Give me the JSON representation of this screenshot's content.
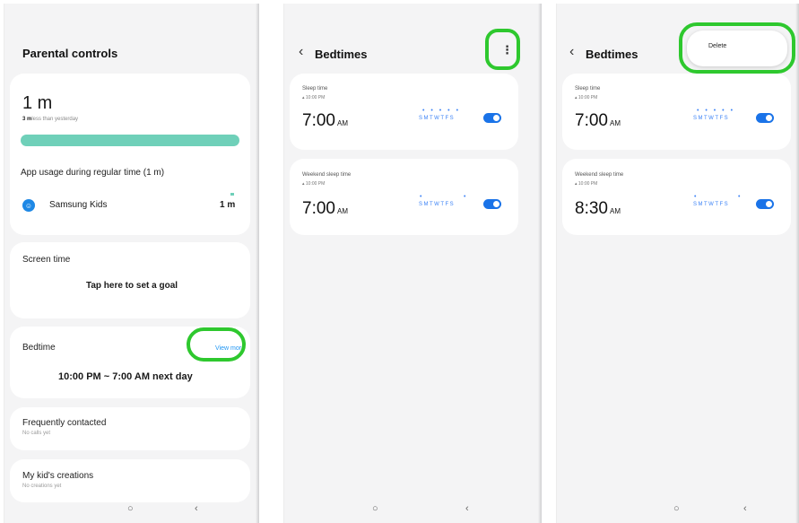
{
  "screen1": {
    "title": "Parental controls",
    "usage_total": "1 m",
    "usage_delta_value": "3 m",
    "usage_delta_text": "less than yesterday",
    "regular_time_label": "App usage during regular time (1 m)",
    "app_name": "Samsung Kids",
    "app_time": "1 m",
    "screen_time_label": "Screen time",
    "screen_time_action": "Tap here to set a goal",
    "bedtime_label": "Bedtime",
    "view_more": "View more",
    "bedtime_range": "10:00 PM ~ 7:00 AM next day",
    "frequently_contacted": "Frequently contacted",
    "no_calls": "No calls yet",
    "creations": "My kid's creations",
    "no_creations": "No creations yet"
  },
  "screen2": {
    "title": "Bedtimes",
    "alarms": [
      {
        "label": "Sleep time",
        "start": "10:00 PM",
        "time": "7:00",
        "ampm": "AM",
        "days": "SMTWTFS",
        "marks": "• • • • •"
      },
      {
        "label": "Weekend sleep time",
        "start": "10:00 PM",
        "time": "7:00",
        "ampm": "AM",
        "days": "SMTWTFS",
        "marks": "•"
      }
    ]
  },
  "screen3": {
    "title": "Bedtimes",
    "menu_delete": "Delete",
    "alarms": [
      {
        "label": "Sleep time",
        "start": "10:00 PM",
        "time": "7:00",
        "ampm": "AM",
        "days": "SMTWTFS",
        "marks": "• • • • •"
      },
      {
        "label": "Weekend sleep time",
        "start": "10:00 PM",
        "time": "8:30",
        "ampm": "AM",
        "days": "SMTWTFS",
        "marks": "•"
      }
    ]
  },
  "nav": {
    "home": "○",
    "back": "‹"
  },
  "colors": {
    "highlight_ring": "#2ec82e",
    "usage_bar": "#6fd0b9",
    "accent_blue": "#1a73e8"
  }
}
